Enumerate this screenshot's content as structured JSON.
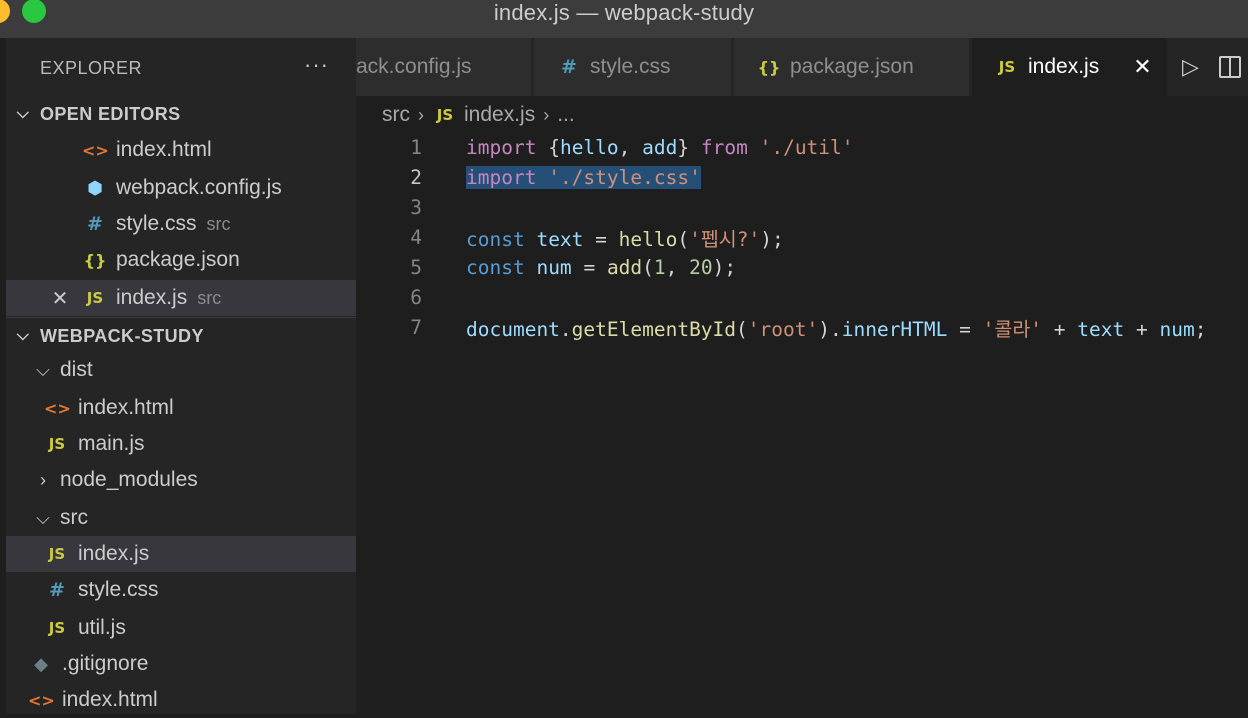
{
  "window": {
    "title": "index.js — webpack-study"
  },
  "sidebar": {
    "header": "EXPLORER",
    "more": "···",
    "open_editors": {
      "label": "OPEN EDITORS",
      "items": [
        {
          "name": "index.html",
          "icon": "html-icon",
          "desc": ""
        },
        {
          "name": "webpack.config.js",
          "icon": "webpack-icon",
          "desc": ""
        },
        {
          "name": "style.css",
          "icon": "css-icon",
          "desc": "src"
        },
        {
          "name": "package.json",
          "icon": "json-icon",
          "desc": ""
        },
        {
          "name": "index.js",
          "icon": "js-icon",
          "desc": "src",
          "active": true
        }
      ]
    },
    "project": {
      "label": "WEBPACK-STUDY",
      "items": [
        {
          "name": "dist",
          "type": "folder-open"
        },
        {
          "name": "index.html",
          "type": "file"
        },
        {
          "name": "main.js",
          "type": "file"
        },
        {
          "name": "node_modules",
          "type": "folder-closed"
        },
        {
          "name": "src",
          "type": "folder-open"
        },
        {
          "name": "index.js",
          "type": "file",
          "selected": true
        },
        {
          "name": "style.css",
          "type": "file"
        },
        {
          "name": "util.js",
          "type": "file"
        },
        {
          "name": ".gitignore",
          "type": "file"
        },
        {
          "name": "index.html",
          "type": "file"
        }
      ]
    }
  },
  "tabs": [
    {
      "label": "ack.config.js",
      "icon": "webpack-icon"
    },
    {
      "label": "style.css",
      "icon": "css-icon"
    },
    {
      "label": "package.json",
      "icon": "json-icon"
    },
    {
      "label": "index.js",
      "icon": "js-icon",
      "active": true
    }
  ],
  "icons": {
    "js": "JS",
    "css": "#",
    "json": "{}",
    "html": "<>",
    "close": "✕",
    "run": "▷",
    "split": "split-editor-icon"
  },
  "breadcrumb": {
    "folder": "src",
    "file": "index.js",
    "more": "..."
  },
  "editor": {
    "lines": [
      {
        "n": "1",
        "text": "import {hello, add} from './util'"
      },
      {
        "n": "2",
        "text": "import './style.css'",
        "selected": true
      },
      {
        "n": "3",
        "text": ""
      },
      {
        "n": "4",
        "text": "const text = hello('펩시?');"
      },
      {
        "n": "5",
        "text": "const num = add(1, 20);"
      },
      {
        "n": "6",
        "text": ""
      },
      {
        "n": "7",
        "text": "document.getElementById('root').innerHTML = '콜라' + text + num;"
      }
    ],
    "tokens": {
      "import": "import",
      "from": "from",
      "const": "const",
      "hello": "hello",
      "add": "add",
      "util": "'./util'",
      "style": "'./style.css'",
      "text": "text",
      "num": "num",
      "pepsi": "'펩시?'",
      "one": "1",
      "twenty": "20",
      "document": "document",
      "getById": "getElementById",
      "root": "'root'",
      "innerHTML": "innerHTML",
      "cola": "'콜라'"
    }
  }
}
